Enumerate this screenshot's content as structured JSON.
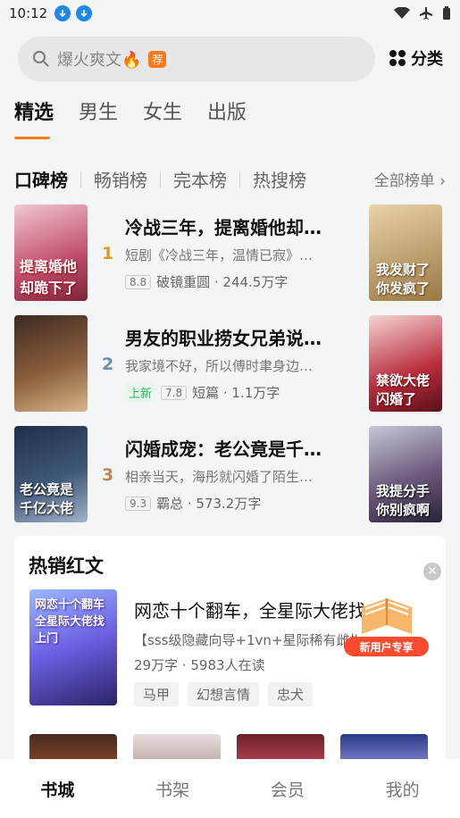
{
  "status": {
    "time": "10:12"
  },
  "search": {
    "placeholder": "爆火爽文🔥",
    "badge": "荐"
  },
  "category_label": "分类",
  "tabs": [
    "精选",
    "男生",
    "女生",
    "出版"
  ],
  "rank_tabs": [
    "口碑榜",
    "畅销榜",
    "完本榜",
    "热搜榜"
  ],
  "all_ranks": "全部榜单 ›",
  "rank_items": [
    {
      "num": "1",
      "title": "冷战三年，提离婚他却…",
      "desc": "短剧《冷战三年，温情已寂》已…",
      "score": "8.8",
      "meta": "破镜重圆 · 244.5万字",
      "new": "",
      "num_color": "#d99a2b",
      "cover_title": "提离婚他却跪下了",
      "side_title": "我发财了你发疯了"
    },
    {
      "num": "2",
      "title": "男友的职业捞女兄弟说…",
      "desc": "我家境不好，所以傅时聿身边的…",
      "score": "7.8",
      "meta": "短篇 · 1.1万字",
      "new": "上新",
      "num_color": "#6f8ea8",
      "cover_title": "",
      "side_title": "禁欲大佬闪婚了"
    },
    {
      "num": "3",
      "title": "闪婚成宠：老公竟是千…",
      "desc": "相亲当天，海彤就闪婚了陌生人…",
      "score": "9.3",
      "meta": "霸总 · 573.2万字",
      "new": "",
      "num_color": "#b9885a",
      "cover_title": "老公竟是千亿大佬",
      "side_title": "我提分手你别疯啊"
    }
  ],
  "hot": {
    "section_title": "热销红文",
    "title": "网恋十个翻车，全星际大佬找",
    "desc": "【sss级隐藏向导+1vn+星际稀有雌性",
    "meta": "29万字 · 5983人在读",
    "tags": [
      "马甲",
      "幻想言情",
      "忠犬"
    ],
    "cover_title": "网恋十个翻车全星际大佬找上门",
    "promo": "新用户专享"
  },
  "bottom_nav": [
    "书城",
    "书架",
    "会员",
    "我的"
  ]
}
